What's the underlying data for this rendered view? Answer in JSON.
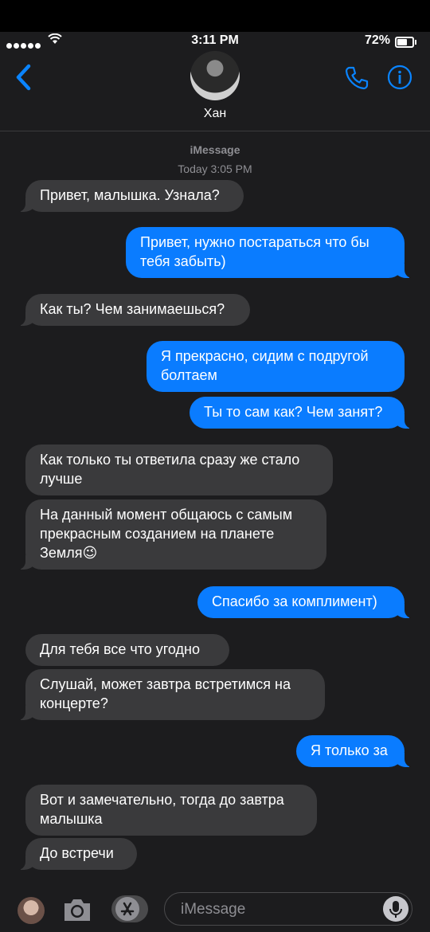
{
  "status": {
    "time": "3:11 PM",
    "battery": "72%",
    "battery_level": 0.72
  },
  "header": {
    "contact_name": "Хан",
    "back_icon": "chevron-left-icon",
    "phone_icon": "phone-icon",
    "info_icon": "info-icon"
  },
  "thread": {
    "service": "iMessage",
    "timestamp": "Today 3:05 PM"
  },
  "messages": [
    {
      "from": "them",
      "text": "Привет, малышка. Узнала?"
    },
    {
      "from": "me",
      "text": "Привет, нужно постараться что бы тебя забыть)"
    },
    {
      "from": "them",
      "text": "Как ты? Чем занимаешься?"
    },
    {
      "from": "me",
      "text": "Я прекрасно, сидим с подругой болтаем"
    },
    {
      "from": "me",
      "text": "Ты то сам как? Чем занят?"
    },
    {
      "from": "them",
      "text": "Как только ты ответила сразу же стало лучше"
    },
    {
      "from": "them",
      "text": "На данный момент общаюсь с самым прекрасным созданием на планете Земля😉"
    },
    {
      "from": "me",
      "text": "Спасибо за комплимент)"
    },
    {
      "from": "them",
      "text": "Для тебя все что угодно"
    },
    {
      "from": "them",
      "text": "Слушай, может завтра встретимся на концерте?"
    },
    {
      "from": "me",
      "text": "Я только за"
    },
    {
      "from": "them",
      "text": "Вот и замечательно, тогда до завтра малышка"
    },
    {
      "from": "them",
      "text": "До встречи"
    }
  ],
  "composer": {
    "placeholder": "iMessage",
    "camera_icon": "camera-icon",
    "appstore_icon": "app-store-icon",
    "mic_icon": "microphone-icon"
  }
}
